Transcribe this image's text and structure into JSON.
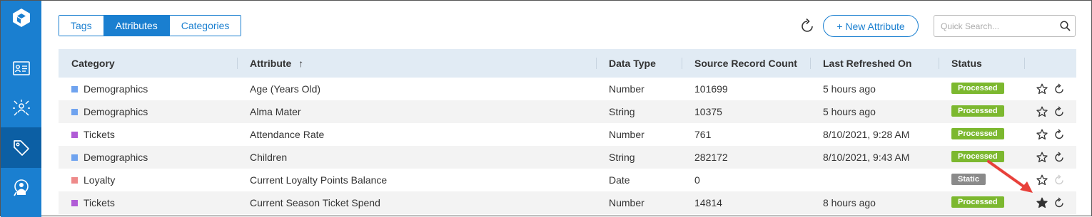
{
  "tabs": [
    {
      "label": "Tags",
      "active": false
    },
    {
      "label": "Attributes",
      "active": true
    },
    {
      "label": "Categories",
      "active": false
    }
  ],
  "toolbar": {
    "new_attribute_label": "+ New Attribute",
    "search_placeholder": "Quick Search...",
    "refresh_icon": "refresh-icon",
    "search_icon": "search-icon"
  },
  "nav": {
    "logo_icon": "cube-logo-icon",
    "items": [
      {
        "icon": "contact-card-icon",
        "active": false
      },
      {
        "icon": "network-hub-icon",
        "active": false
      },
      {
        "icon": "tag-icon",
        "active": true
      },
      {
        "icon": "user-search-icon",
        "active": false
      }
    ]
  },
  "table": {
    "columns": [
      "Category",
      "Attribute",
      "Data Type",
      "Source Record Count",
      "Last Refreshed On",
      "Status"
    ],
    "sort_indicator": "↑",
    "rows": [
      {
        "category": "Demographics",
        "category_color": "#6fa3ef",
        "attribute": "Age (Years Old)",
        "data_type": "Number",
        "count": "101699",
        "refreshed": "5 hours ago",
        "status": "Processed",
        "favorite": false,
        "refresh_enabled": true
      },
      {
        "category": "Demographics",
        "category_color": "#6fa3ef",
        "attribute": "Alma Mater",
        "data_type": "String",
        "count": "10375",
        "refreshed": "5 hours ago",
        "status": "Processed",
        "favorite": false,
        "refresh_enabled": true
      },
      {
        "category": "Tickets",
        "category_color": "#b05cd6",
        "attribute": "Attendance Rate",
        "data_type": "Number",
        "count": "761",
        "refreshed": "8/10/2021, 9:28 AM",
        "status": "Processed",
        "favorite": false,
        "refresh_enabled": true
      },
      {
        "category": "Demographics",
        "category_color": "#6fa3ef",
        "attribute": "Children",
        "data_type": "String",
        "count": "282172",
        "refreshed": "8/10/2021, 9:43 AM",
        "status": "Processed",
        "favorite": false,
        "refresh_enabled": true
      },
      {
        "category": "Loyalty",
        "category_color": "#ee8a8a",
        "attribute": "Current Loyalty Points Balance",
        "data_type": "Date",
        "count": "0",
        "refreshed": "",
        "status": "Static",
        "favorite": false,
        "refresh_enabled": false
      },
      {
        "category": "Tickets",
        "category_color": "#b05cd6",
        "attribute": "Current Season Ticket Spend",
        "data_type": "Number",
        "count": "14814",
        "refreshed": "8 hours ago",
        "status": "Processed",
        "favorite": true,
        "refresh_enabled": true
      }
    ]
  },
  "status_colors": {
    "Processed": "#7cb82f",
    "Static": "#8a8a8a"
  },
  "colors": {
    "accent": "#1a7fd0",
    "nav_active": "#0c5fa4",
    "header_bg": "#e1ebf4",
    "annotation_arrow": "#e8413b"
  }
}
